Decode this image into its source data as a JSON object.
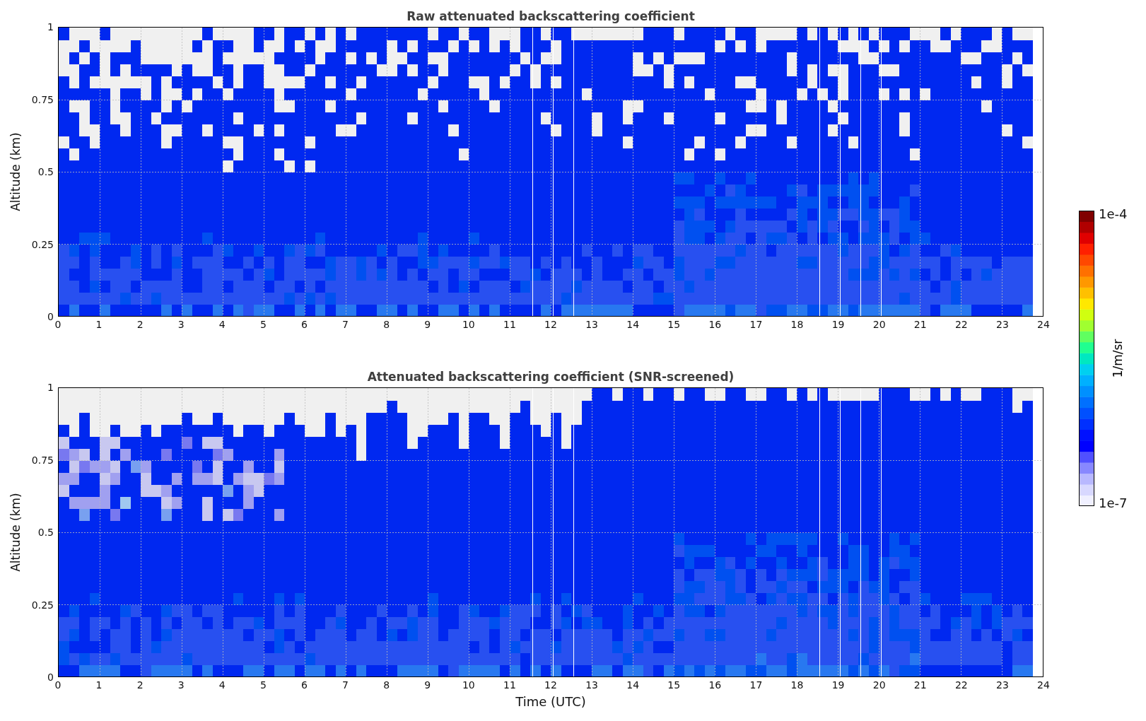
{
  "panels": [
    {
      "kind": "raw",
      "title": "Raw attenuated backscattering coefficient",
      "ylabel": "Altitude (km)",
      "yticks": [
        "1",
        "0.75",
        "0.5",
        "0.25",
        "0"
      ],
      "xticks": [
        "0",
        "1",
        "2",
        "3",
        "4",
        "5",
        "6",
        "7",
        "8",
        "9",
        "10",
        "11",
        "12",
        "13",
        "14",
        "15",
        "16",
        "17",
        "18",
        "19",
        "20",
        "21",
        "22",
        "23",
        "24"
      ]
    },
    {
      "kind": "screened",
      "title": "Attenuated backscattering coefficient (SNR-screened)",
      "ylabel": "Altitude (km)",
      "yticks": [
        "1",
        "0.75",
        "0.5",
        "0.25",
        "0"
      ],
      "xticks": [
        "0",
        "1",
        "2",
        "3",
        "4",
        "5",
        "6",
        "7",
        "8",
        "9",
        "10",
        "11",
        "12",
        "13",
        "14",
        "15",
        "16",
        "17",
        "18",
        "19",
        "20",
        "21",
        "22",
        "23",
        "24"
      ]
    }
  ],
  "xlabel": "Time (UTC)",
  "colorbar": {
    "label": "1/m/sr",
    "max": "1e-4",
    "min": "1e-7"
  }
}
